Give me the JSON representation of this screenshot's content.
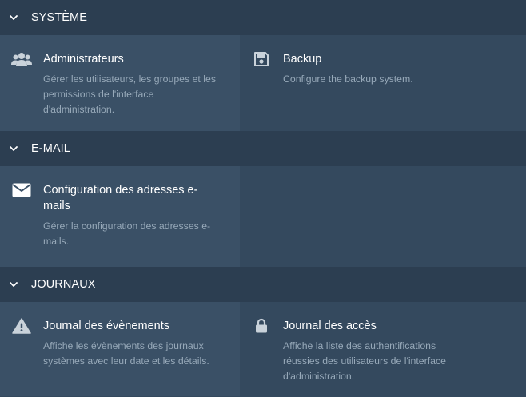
{
  "sections": [
    {
      "title": "SYSTÈME",
      "tiles": [
        {
          "icon": "users-icon",
          "title": "Administrateurs",
          "description": "Gérer les utilisateurs, les groupes et les permissions de l'interface d'administration."
        },
        {
          "icon": "floppy-disk-icon",
          "title": "Backup",
          "description": "Configure the backup system."
        }
      ]
    },
    {
      "title": "E-MAIL",
      "tiles": [
        {
          "icon": "envelope-icon",
          "title": "Configuration des adresses e-mails",
          "description": "Gérer la configuration des adresses e-mails."
        }
      ]
    },
    {
      "title": "JOURNAUX",
      "tiles": [
        {
          "icon": "warning-icon",
          "title": "Journal des évènements",
          "description": "Affiche les évènements des journaux systèmes avec leur date et les détails."
        },
        {
          "icon": "lock-icon",
          "title": "Journal des accès",
          "description": "Affiche la liste des authentifications réussies des utilisateurs de l'interface d'administration."
        }
      ]
    }
  ],
  "colors": {
    "header_bg": "#2c3e51",
    "body_bg": "#34495e",
    "tile_bg": "#3a5066",
    "title_text": "#ffffff",
    "desc_text": "#97a9b9",
    "icon": "#c9d2da"
  }
}
